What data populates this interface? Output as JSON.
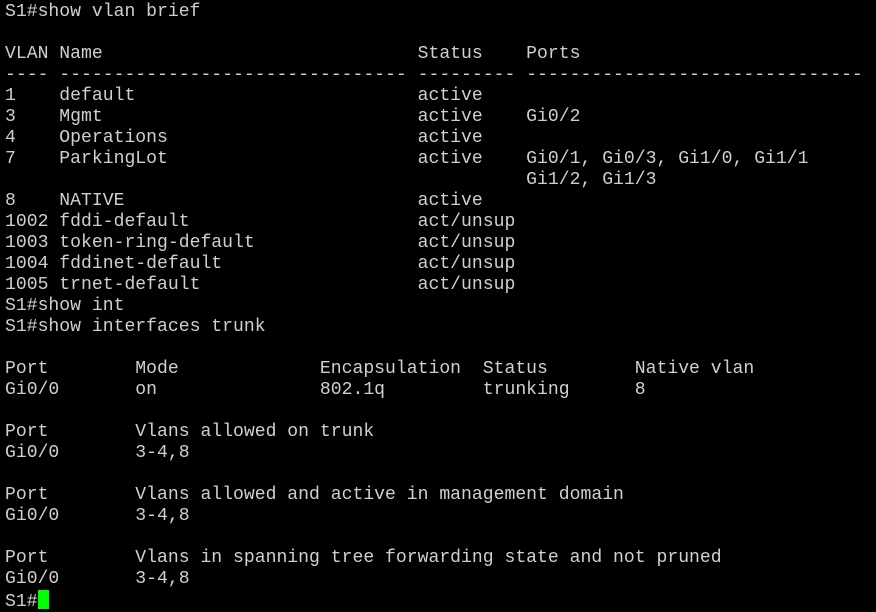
{
  "terminal": {
    "lines": [
      "S1#show vlan brief",
      "",
      "VLAN Name                             Status    Ports",
      "---- -------------------------------- --------- -------------------------------",
      "1    default                          active",
      "3    Mgmt                             active    Gi0/2",
      "4    Operations                       active",
      "7    ParkingLot                       active    Gi0/1, Gi0/3, Gi1/0, Gi1/1",
      "                                                Gi1/2, Gi1/3",
      "8    NATIVE                           active",
      "1002 fddi-default                     act/unsup",
      "1003 token-ring-default               act/unsup",
      "1004 fddinet-default                  act/unsup",
      "1005 trnet-default                    act/unsup",
      "S1#show int",
      "S1#show interfaces trunk",
      "",
      "Port        Mode             Encapsulation  Status        Native vlan",
      "Gi0/0       on               802.1q         trunking      8",
      "",
      "Port        Vlans allowed on trunk",
      "Gi0/0       3-4,8",
      "",
      "Port        Vlans allowed and active in management domain",
      "Gi0/0       3-4,8",
      "",
      "Port        Vlans in spanning tree forwarding state and not pruned",
      "Gi0/0       3-4,8"
    ],
    "prompt": "S1#",
    "cursor_color": "#00ff00",
    "text_color": "#cfcfcf",
    "background_color": "#000000"
  }
}
